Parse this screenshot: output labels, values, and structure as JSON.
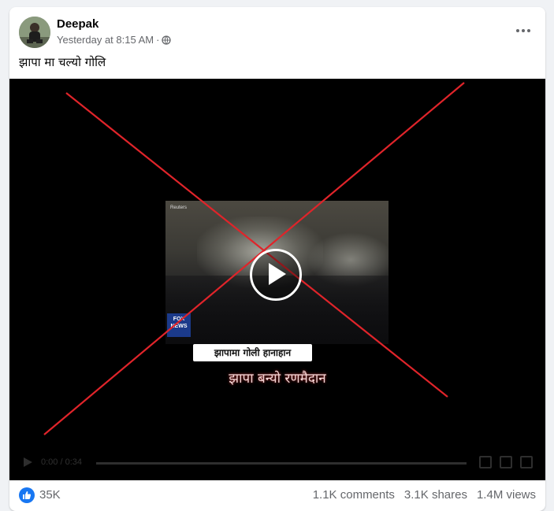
{
  "post": {
    "author": "Deepak",
    "timestamp": "Yesterday at 8:15 AM",
    "separator": "·",
    "privacy_icon": "globe-icon",
    "caption": "झापा मा चल्यो गोलि"
  },
  "video": {
    "channel_badge": "Reuters",
    "logo_text": "FOX NEWS",
    "subtitle_box": "झापामा गोली हानाहान",
    "subtitle_line": "झापा बन्यो रणमैदान",
    "overlay_mark": "red-x-cross",
    "time": "0:00 / 0:34"
  },
  "footer": {
    "reaction_icon": "thumbs-up-icon",
    "likes": "35K",
    "comments": "1.1K comments",
    "shares": "3.1K shares",
    "views": "1.4M views"
  },
  "colors": {
    "brand_blue": "#1877f2",
    "x_red": "#e0242a",
    "secondary_text": "#65676b"
  }
}
